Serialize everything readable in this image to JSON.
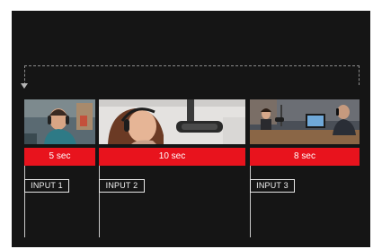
{
  "timeline": {
    "clips": [
      {
        "duration_label": "5 sec",
        "input_label": "INPUT 1",
        "thumbnail": "man-with-headphones"
      },
      {
        "duration_label": "10 sec",
        "input_label": "INPUT 2",
        "thumbnail": "woman-at-microphone"
      },
      {
        "duration_label": "8 sec",
        "input_label": "INPUT 3",
        "thumbnail": "podcast-studio-two-hosts"
      }
    ],
    "accent_color": "#e8131d",
    "background_color": "#151515",
    "loop_icon": "loop-arrow-icon"
  }
}
